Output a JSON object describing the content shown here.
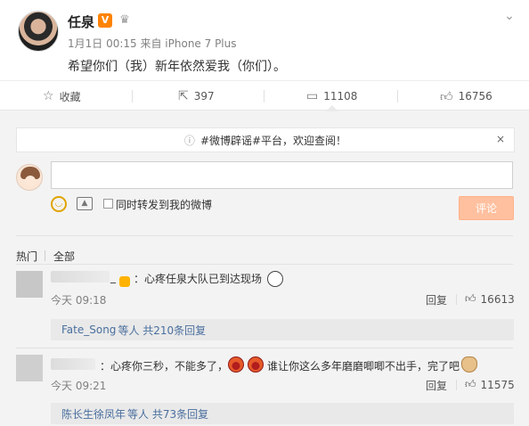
{
  "post": {
    "author": "任泉",
    "verified_badge": "V",
    "meta": "1月1日 00:15 来自 iPhone 7 Plus",
    "text": "希望你们（我）新年依然爱我（你们）。"
  },
  "actions": {
    "favorite": "收藏",
    "repost_count": "397",
    "comment_count": "11108",
    "like_count": "16756"
  },
  "notice": {
    "text": "#微博辟谣#平台，欢迎查阅！",
    "close": "×"
  },
  "composer": {
    "input_value": "",
    "repost_checkbox_label": "同时转发到我的微博",
    "submit_label": "评论"
  },
  "sort": {
    "hot": "热门",
    "all": "全部"
  },
  "comments": [
    {
      "name_visible": "_",
      "text": "：心疼任泉大队已到达现场",
      "time": "今天 09:18",
      "reply_label": "回复",
      "likes": "16613",
      "replies_name": "Fate_Song",
      "replies_rest": " 等人 共210条回复"
    },
    {
      "name_visible": "",
      "text_a": "：心疼你三秒，不能多了，",
      "text_b": "谁让你这么多年磨磨唧唧不出手，完了吧",
      "time": "今天 09:21",
      "reply_label": "回复",
      "likes": "11575",
      "replies_name": "陈长生徐凤年",
      "replies_rest": " 等人 共73条回复"
    }
  ],
  "colors": {
    "accent": "#ff8200",
    "link": "#4a6f9e",
    "submit_disabled": "#ffc09f"
  },
  "icons": [
    "chevron-down-icon",
    "star-icon",
    "repost-icon",
    "comment-icon",
    "thumb-up-icon",
    "info-icon",
    "close-icon",
    "emoji-icon",
    "image-icon"
  ]
}
